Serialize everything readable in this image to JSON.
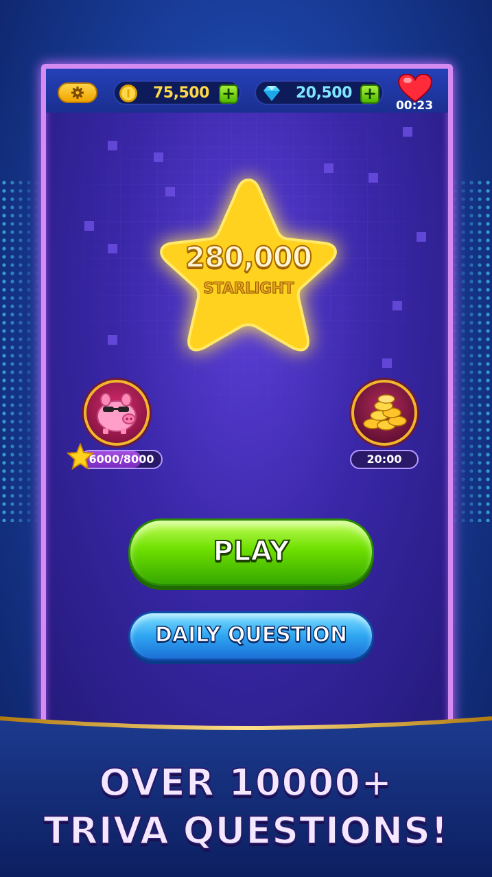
{
  "hud": {
    "coins": "75,500",
    "gems": "20,500",
    "lives_timer": "00:23",
    "plus_symbol": "+"
  },
  "star": {
    "value": "280,000",
    "label": "STARLIGHT"
  },
  "piggy_bank": {
    "progress_text": "6000/8000",
    "progress_fraction": 0.75
  },
  "coin_reward": {
    "timer": "20:00"
  },
  "buttons": {
    "play": "PLAY",
    "daily_question": "DAILY QUESTION"
  },
  "banner": {
    "line1": "OVER 10000+",
    "line2": "TRIVA QUESTIONS!"
  },
  "colors": {
    "coin_text": "#ffd84a",
    "gem_text": "#7fe6ff",
    "play_green": "#6ee000",
    "daily_blue": "#2fa6f2",
    "frame_pink": "#d48cf2"
  },
  "icons": [
    "gear-icon",
    "coin-icon",
    "gem-icon",
    "heart-icon",
    "star-icon",
    "piggy-bank-icon",
    "coin-pile-icon",
    "plus-icon"
  ]
}
